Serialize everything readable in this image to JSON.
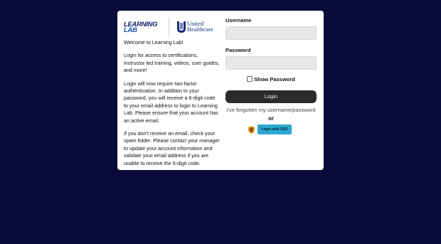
{
  "branding": {
    "learning_lab_line1": "LEARNING",
    "learning_lab_line2": "LAB",
    "uhc_line1": "United",
    "uhc_line2": "Healthcare"
  },
  "intro": {
    "welcome": "Welcome to Learning Lab!",
    "para1": "Login for access to certifications, instructor led training, videos, user guides, and more!",
    "para2": "Login will now require two-factor authentication. In addition to your password, you will receive a 6-digit code to your email address to login to Learning Lab. Please ensure that your account has an active email.",
    "para3": "If you don't receive an email, check your spam folder. Please contact your manager to update your account information and validate your email address if you are unable to receive the 6-digit code."
  },
  "form": {
    "username_label": "Username",
    "username_value": "",
    "password_label": "Password",
    "password_value": "",
    "show_password_label": "Show Password",
    "login_button": "Login",
    "forgot_link": "I've forgotten my username/password",
    "or_text": "or",
    "sso_button": "Login with SSO"
  },
  "colors": {
    "background": "#0b0b3b",
    "login_button": "#2b2b2b",
    "sso_button": "#29a9cf"
  }
}
